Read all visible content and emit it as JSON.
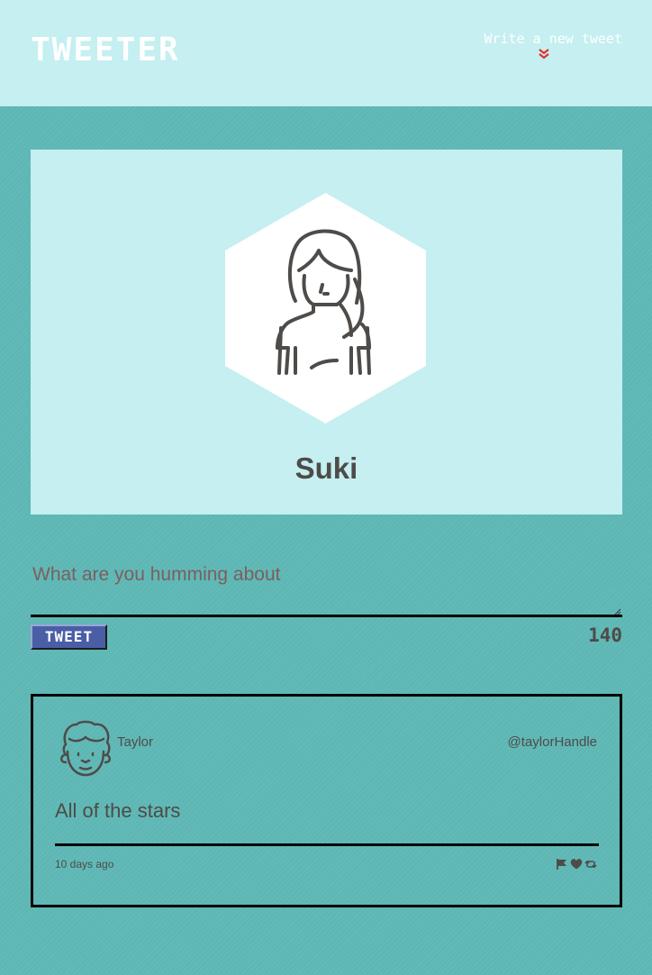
{
  "app": {
    "brand": "TWEETER"
  },
  "nav": {
    "compose_toggle_label": "Write a new tweet",
    "compose_toggle_icon": "double-chevron-down-icon",
    "chevron_color": "#e0332b"
  },
  "profile": {
    "name": "Suki",
    "avatar_icon": "woman-avatar-icon"
  },
  "compose": {
    "placeholder": "What are you humming about",
    "value": "",
    "button_label": "TWEET",
    "char_count": "140"
  },
  "tweets": [
    {
      "author": "Taylor",
      "handle": "@taylorHandle",
      "text": "All of the stars",
      "time": "10 days ago",
      "avatar_icon": "curly-hair-man-avatar-icon",
      "actions": [
        "flag-icon",
        "heart-icon",
        "retweet-icon"
      ]
    }
  ],
  "colors": {
    "page_background": "#5fb9b6",
    "panel_background": "#c5eff0",
    "button_background": "#4a5ea6",
    "text": "#4e4b48"
  }
}
